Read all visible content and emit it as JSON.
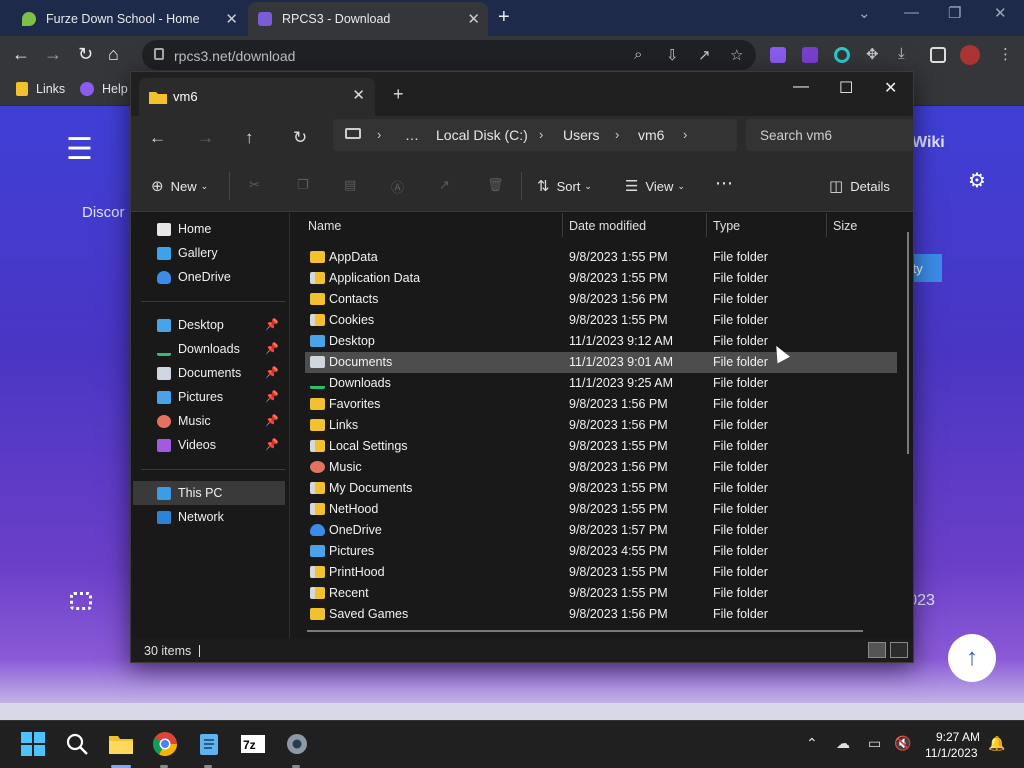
{
  "browser": {
    "tabs": [
      {
        "title": "Furze Down School - Home"
      },
      {
        "title": "RPCS3 - Download"
      }
    ],
    "url": "rpcs3.net/download",
    "bookmarks": [
      {
        "label": "Links"
      },
      {
        "label": "Help"
      }
    ]
  },
  "webpage": {
    "nav_partial": "Wiki",
    "discord_partial": "Discor",
    "compat_partial": "ility",
    "year_partial": "e 2023"
  },
  "explorer": {
    "tab_title": "vm6",
    "breadcrumb": [
      "Local Disk (C:)",
      "Users",
      "vm6"
    ],
    "search_placeholder": "Search vm6",
    "commands": {
      "new": "New",
      "sort": "Sort",
      "view": "View",
      "details": "Details"
    },
    "nav_pane": {
      "top": [
        {
          "label": "Home",
          "icon": "home-icon"
        },
        {
          "label": "Gallery",
          "icon": "gallery-icon"
        },
        {
          "label": "OneDrive",
          "icon": "onedrive-icon"
        }
      ],
      "quick_access": [
        {
          "label": "Desktop",
          "icon": "desktop-icon"
        },
        {
          "label": "Downloads",
          "icon": "downloads-icon"
        },
        {
          "label": "Documents",
          "icon": "documents-icon"
        },
        {
          "label": "Pictures",
          "icon": "pictures-icon"
        },
        {
          "label": "Music",
          "icon": "music-icon"
        },
        {
          "label": "Videos",
          "icon": "videos-icon"
        }
      ],
      "devices": [
        {
          "label": "This PC",
          "icon": "this-pc-icon"
        },
        {
          "label": "Network",
          "icon": "network-icon"
        }
      ]
    },
    "columns": [
      "Name",
      "Date modified",
      "Type",
      "Size"
    ],
    "files": [
      {
        "name": "AppData",
        "date": "9/8/2023 1:55 PM",
        "type": "File folder",
        "icon": "folder-icon"
      },
      {
        "name": "Application Data",
        "date": "9/8/2023 1:55 PM",
        "type": "File folder",
        "icon": "shortcut-folder-icon"
      },
      {
        "name": "Contacts",
        "date": "9/8/2023 1:56 PM",
        "type": "File folder",
        "icon": "folder-icon"
      },
      {
        "name": "Cookies",
        "date": "9/8/2023 1:55 PM",
        "type": "File folder",
        "icon": "shortcut-folder-icon"
      },
      {
        "name": "Desktop",
        "date": "11/1/2023 9:12 AM",
        "type": "File folder",
        "icon": "desktop-icon"
      },
      {
        "name": "Documents",
        "date": "11/1/2023 9:01 AM",
        "type": "File folder",
        "icon": "documents-icon"
      },
      {
        "name": "Downloads",
        "date": "11/1/2023 9:25 AM",
        "type": "File folder",
        "icon": "downloads-icon"
      },
      {
        "name": "Favorites",
        "date": "9/8/2023 1:56 PM",
        "type": "File folder",
        "icon": "folder-icon"
      },
      {
        "name": "Links",
        "date": "9/8/2023 1:56 PM",
        "type": "File folder",
        "icon": "folder-icon"
      },
      {
        "name": "Local Settings",
        "date": "9/8/2023 1:55 PM",
        "type": "File folder",
        "icon": "shortcut-folder-icon"
      },
      {
        "name": "Music",
        "date": "9/8/2023 1:56 PM",
        "type": "File folder",
        "icon": "music-icon"
      },
      {
        "name": "My Documents",
        "date": "9/8/2023 1:55 PM",
        "type": "File folder",
        "icon": "shortcut-folder-icon"
      },
      {
        "name": "NetHood",
        "date": "9/8/2023 1:55 PM",
        "type": "File folder",
        "icon": "shortcut-folder-icon"
      },
      {
        "name": "OneDrive",
        "date": "9/8/2023 1:57 PM",
        "type": "File folder",
        "icon": "onedrive-icon"
      },
      {
        "name": "Pictures",
        "date": "9/8/2023 4:55 PM",
        "type": "File folder",
        "icon": "pictures-icon"
      },
      {
        "name": "PrintHood",
        "date": "9/8/2023 1:55 PM",
        "type": "File folder",
        "icon": "shortcut-folder-icon"
      },
      {
        "name": "Recent",
        "date": "9/8/2023 1:55 PM",
        "type": "File folder",
        "icon": "shortcut-folder-icon"
      },
      {
        "name": "Saved Games",
        "date": "9/8/2023 1:56 PM",
        "type": "File folder",
        "icon": "folder-icon"
      }
    ],
    "selected_file": "Documents",
    "item_count": "30 items"
  },
  "taskbar": {
    "apps": [
      "start-icon",
      "search-icon",
      "file-explorer-icon",
      "chrome-icon",
      "notepad-icon",
      "7zip-icon",
      "settings-icon"
    ],
    "time": "9:27 AM",
    "date": "11/1/2023"
  },
  "colors": {
    "accent": "#4a7cf0",
    "folder": "#f2c12e",
    "page_gradient_top": "#3f3fd6",
    "page_gradient_bottom": "#8a5ad8",
    "selected_row": "#4d4d4d"
  }
}
